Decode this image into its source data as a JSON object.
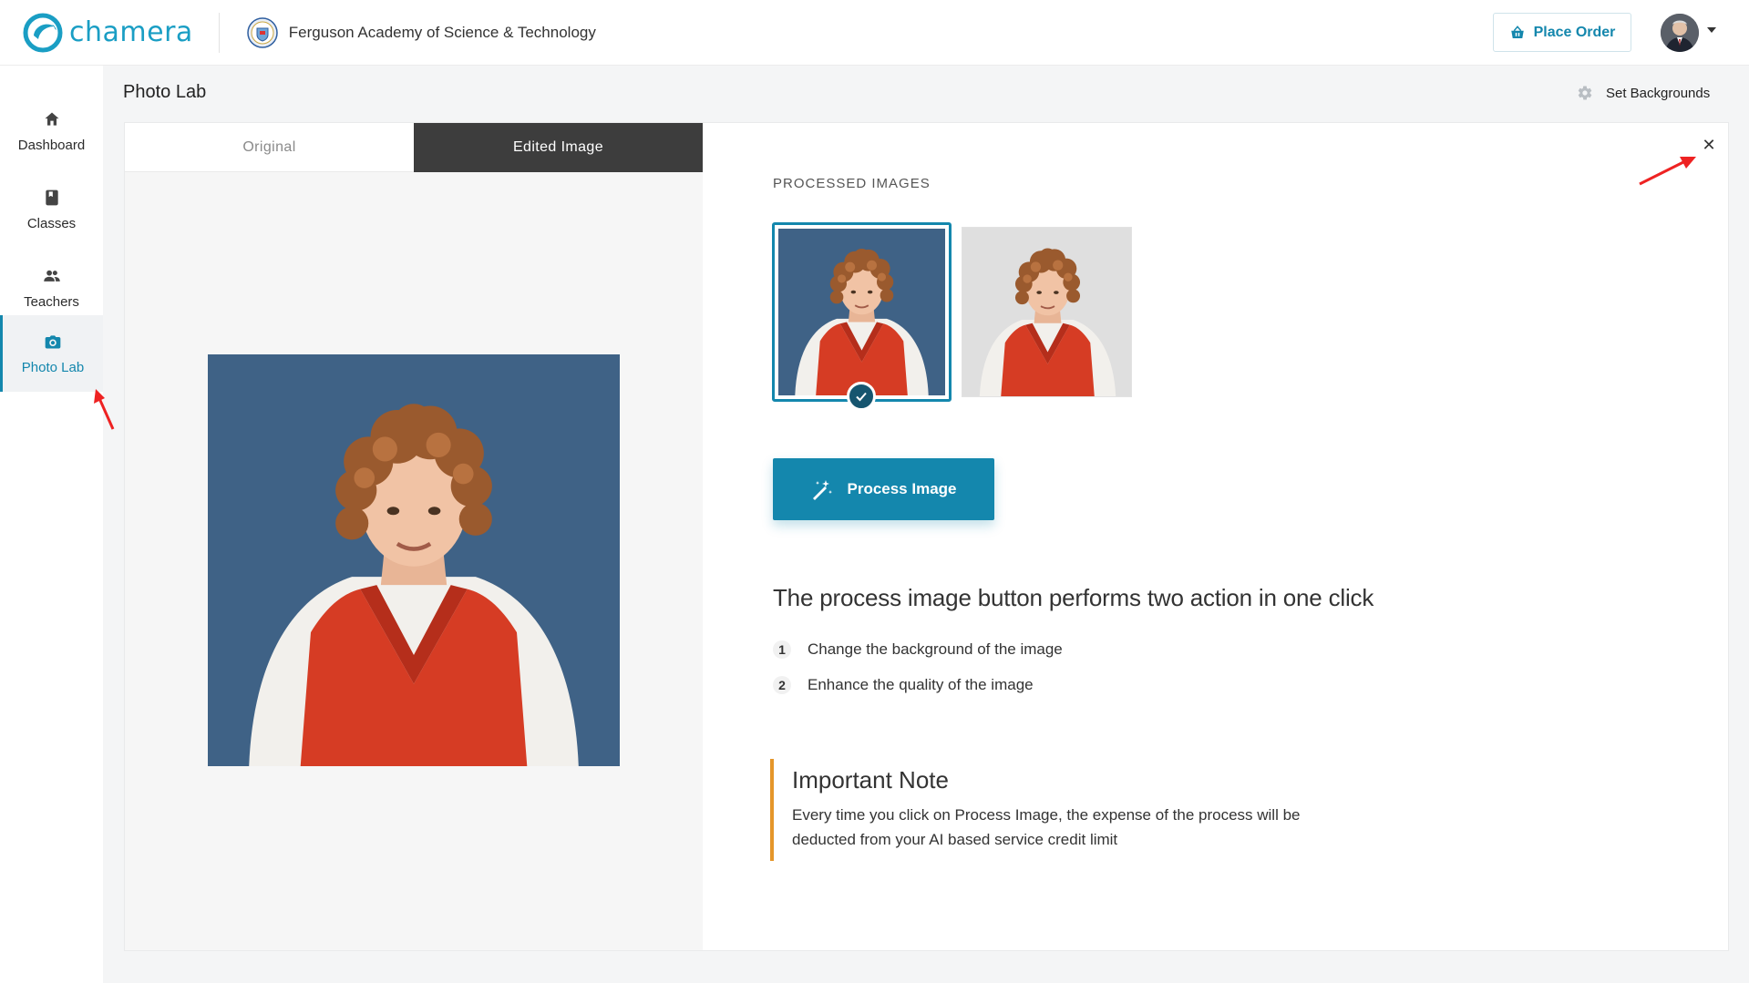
{
  "header": {
    "brand_name": "chamera",
    "school_name": "Ferguson Academy of Science & Technology",
    "place_order_label": "Place Order"
  },
  "sidebar": {
    "items": [
      {
        "label": "Dashboard",
        "icon": "home-icon"
      },
      {
        "label": "Classes",
        "icon": "book-icon"
      },
      {
        "label": "Teachers",
        "icon": "people-icon"
      },
      {
        "label": "Photo Lab",
        "icon": "camera-icon",
        "active": true
      }
    ]
  },
  "page": {
    "title": "Photo Lab",
    "set_backgrounds_label": "Set Backgrounds"
  },
  "editor": {
    "tabs": [
      {
        "label": "Original",
        "active": false
      },
      {
        "label": "Edited Image",
        "active": true
      }
    ],
    "processed_label": "PROCESSED IMAGES",
    "process_button_label": "Process Image",
    "headline": "The process image button performs two action in one click",
    "steps": [
      {
        "num": "1",
        "text": "Change the background of the image"
      },
      {
        "num": "2",
        "text": "Enhance the quality of the image"
      }
    ],
    "note_title": "Important Note",
    "note_text": "Every time you click on Process Image, the expense of the process will be deducted from your AI based service credit limit",
    "close_glyph": "✕"
  },
  "colors": {
    "accent": "#1487ad",
    "blue_background": "#3f6286",
    "gray_background": "#dfdfdf",
    "note_accent": "#e5962a",
    "active_tab": "#3d3d3d"
  }
}
